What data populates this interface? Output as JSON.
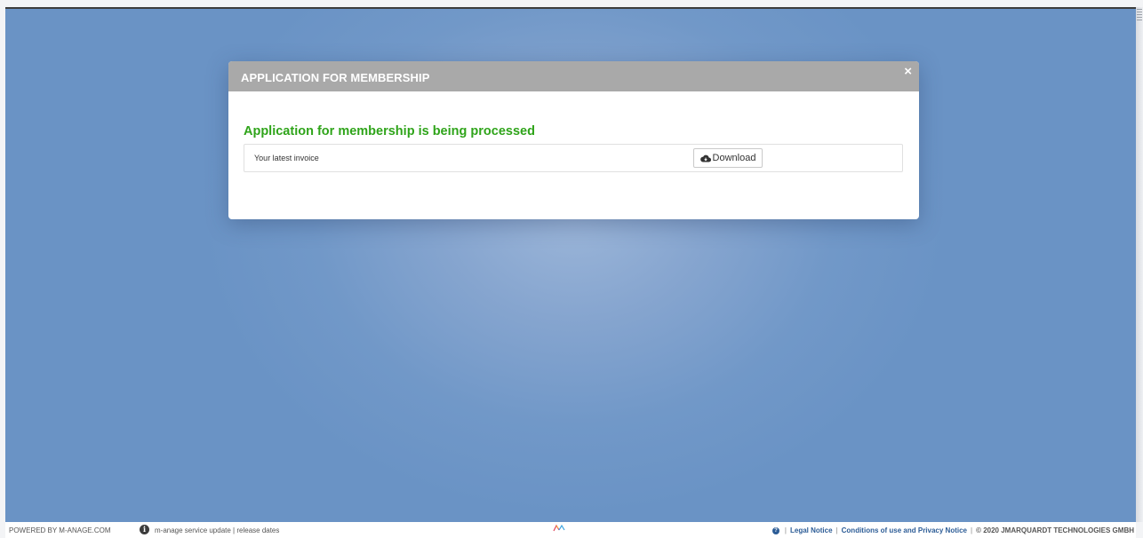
{
  "modal": {
    "title": "APPLICATION FOR MEMBERSHIP",
    "close_label": "×",
    "status_heading": "Application for membership is being processed",
    "invoice_label": "Your latest invoice",
    "download_label": "Download"
  },
  "footer": {
    "powered_by": "POWERED BY M-ANAGE.COM",
    "service_update": "m-anage service update | release dates",
    "separator": "|",
    "legal_notice": "Legal Notice",
    "conditions": "Conditions of use and Privacy Notice",
    "copyright": "© 2020 JMARQUARDT TECHNOLOGIES GMBH"
  },
  "colors": {
    "modal_header": "#a9a9a9",
    "status_green": "#2fa41a",
    "link_blue": "#2c5c96",
    "backdrop_blue": "#7198c8"
  },
  "icons": {
    "close": "close-icon",
    "download": "cloud-download-icon",
    "info": "info-icon",
    "help": "question-circle-icon",
    "logo": "m-anage-logo-icon"
  }
}
